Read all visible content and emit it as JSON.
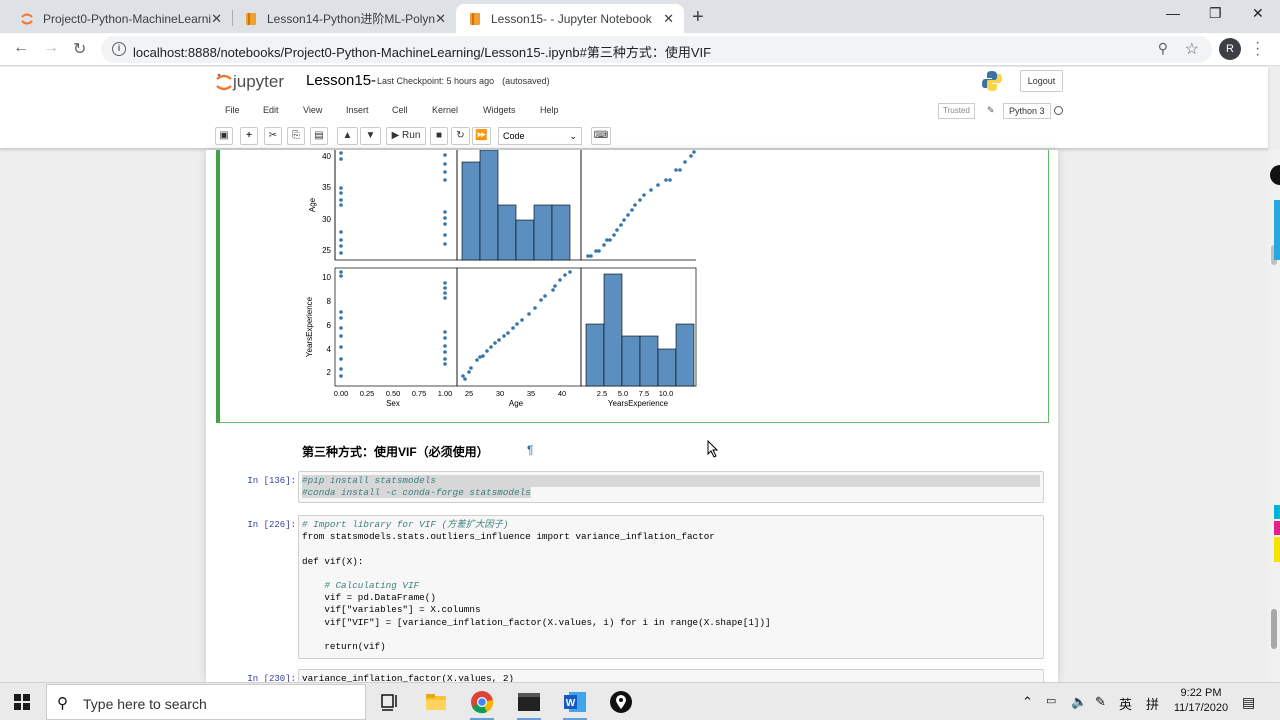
{
  "browser": {
    "tabs": [
      {
        "title": "Project0-Python-MachineLearnin",
        "active": false
      },
      {
        "title": "Lesson14-Python进阶ML-Polync",
        "active": false
      },
      {
        "title": "Lesson15- - Jupyter Notebook",
        "active": true
      }
    ],
    "url": "localhost:8888/notebooks/Project0-Python-MachineLearning/Lesson15-.ipynb#第三种方式：使用VIF",
    "profile_initial": "R"
  },
  "jupyter": {
    "logo_text": "jupyter",
    "notebook_name": "Lesson15-",
    "checkpoint": "Last Checkpoint: 5 hours ago",
    "autosave": "(autosaved)",
    "logout": "Logout",
    "menu": [
      "File",
      "Edit",
      "View",
      "Insert",
      "Cell",
      "Kernel",
      "Widgets",
      "Help"
    ],
    "trusted": "Trusted",
    "kernel": "Python 3",
    "toolbar": {
      "run": "Run",
      "cell_type": "Code"
    }
  },
  "plot": {
    "y_labels": [
      "Age",
      "YearsExperience"
    ],
    "x_labels": [
      "Sex",
      "Age",
      "YearsExperience"
    ],
    "age_y_ticks": [
      "40",
      "35",
      "30",
      "25"
    ],
    "yrs_y_ticks": [
      "10",
      "8",
      "6",
      "4",
      "2"
    ],
    "sex_x_ticks": [
      "0.00",
      "0.25",
      "0.50",
      "0.75",
      "1.00"
    ],
    "age_x_ticks": [
      "25",
      "30",
      "35",
      "40"
    ],
    "yrs_x_ticks": [
      "2.5",
      "5.0",
      "7.5",
      "10.0"
    ]
  },
  "notebook": {
    "heading": "第三种方式：使用VIF（必须使用）",
    "pilcrow": "¶",
    "cells": [
      {
        "prompt": "In [136]:",
        "lines": [
          "#pip install statsmodels",
          "#conda install -c conda-forge statsmodels"
        ]
      },
      {
        "prompt": "In [226]:",
        "lines": [
          "# Import library for VIF (方差扩大因子)",
          "from statsmodels.stats.outliers_influence import variance_inflation_factor",
          "",
          "def vif(X):",
          "",
          "    # Calculating VIF",
          "    vif = pd.DataFrame()",
          "    vif[\"variables\"] = X.columns",
          "    vif[\"VIF\"] = [variance_inflation_factor(X.values, i) for i in range(X.shape[1])]",
          "",
          "    return(vif)"
        ]
      },
      {
        "prompt": "In [230]:",
        "lines": [
          "variance_inflation_factor(X.values, 2)"
        ]
      }
    ]
  },
  "taskbar": {
    "search_placeholder": "Type here to search",
    "time": "9:22 PM",
    "date": "11/17/2020",
    "lang": "英",
    "ime": "拼"
  }
}
